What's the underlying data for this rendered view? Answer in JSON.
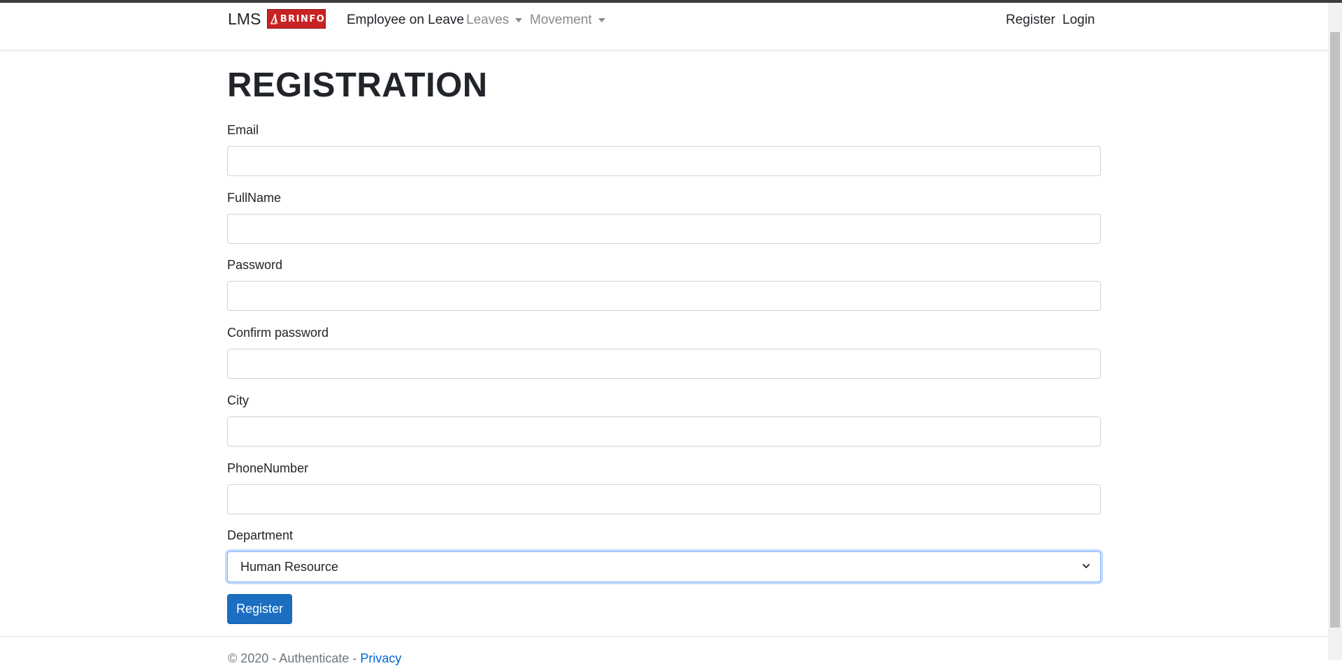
{
  "navbar": {
    "brand": "LMS",
    "logo_text": "BRINFO",
    "links": [
      {
        "label": "Employee on Leave"
      },
      {
        "label": "Leaves"
      },
      {
        "label": "Movement"
      }
    ],
    "right_links": [
      {
        "label": "Register"
      },
      {
        "label": "Login"
      }
    ]
  },
  "form": {
    "title": "REGISTRATION",
    "fields": [
      {
        "label": "Email",
        "value": ""
      },
      {
        "label": "FullName",
        "value": ""
      },
      {
        "label": "Password",
        "value": ""
      },
      {
        "label": "Confirm password",
        "value": ""
      },
      {
        "label": "City",
        "value": ""
      },
      {
        "label": "PhoneNumber",
        "value": ""
      }
    ],
    "department": {
      "label": "Department",
      "selected": "Human Resource"
    },
    "submit_label": "Register"
  },
  "footer": {
    "copyright": "© 2020 - Authenticate - ",
    "privacy": "Privacy"
  },
  "colors": {
    "primary": "#1b6ec2",
    "logo_red": "#c82323",
    "focus_border": "#86b7fe"
  }
}
